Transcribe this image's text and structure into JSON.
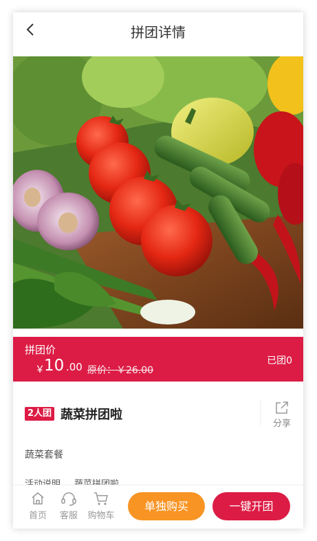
{
  "header": {
    "title": "拼团详情",
    "back_icon": "chevron-left-icon"
  },
  "hero": {
    "alt": ""
  },
  "price": {
    "label": "拼团价",
    "currency": "￥",
    "integer": "10",
    "decimal": ".00",
    "original": "原价：￥26.00",
    "grouped": "已团0"
  },
  "product": {
    "badge": "2人团",
    "name": "蔬菜拼团啦",
    "share_label": "分享",
    "share_icon": "share-icon",
    "subtitle": "蔬菜套餐"
  },
  "activity": {
    "label": "活动说明",
    "value": "蔬菜拼团啦"
  },
  "bottom": {
    "tabs": [
      {
        "label": "首页",
        "icon": "home-icon"
      },
      {
        "label": "客服",
        "icon": "headset-icon"
      },
      {
        "label": "购物车",
        "icon": "cart-icon"
      }
    ],
    "buy_alone": "单独购买",
    "start_group": "一键开团"
  },
  "colors": {
    "accent": "#dc1c45",
    "orange": "#f89424"
  }
}
